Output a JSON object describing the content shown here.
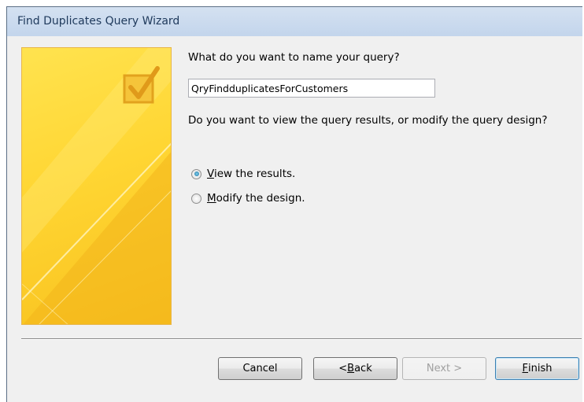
{
  "window": {
    "title": "Find Duplicates Query Wizard"
  },
  "art": {
    "icon": "checkmark-box-icon"
  },
  "form": {
    "name_question": "What do you want to name your query?",
    "query_name_value": "QryFindduplicatesForCustomers",
    "view_question": "Do you want to view the query results, or modify the query design?",
    "options": [
      {
        "key": "V",
        "rest": "iew the results.",
        "selected": true
      },
      {
        "key": "M",
        "rest": "odify the design.",
        "selected": false
      }
    ]
  },
  "buttons": {
    "cancel": "Cancel",
    "back_prefix": "< ",
    "back_key": "B",
    "back_rest": "ack",
    "next": "Next >",
    "finish_key": "F",
    "finish_rest": "inish"
  },
  "colors": {
    "titlebar": "#c3d5ec",
    "art_yellow": "#ffd633",
    "art_border": "#e8b64b"
  }
}
